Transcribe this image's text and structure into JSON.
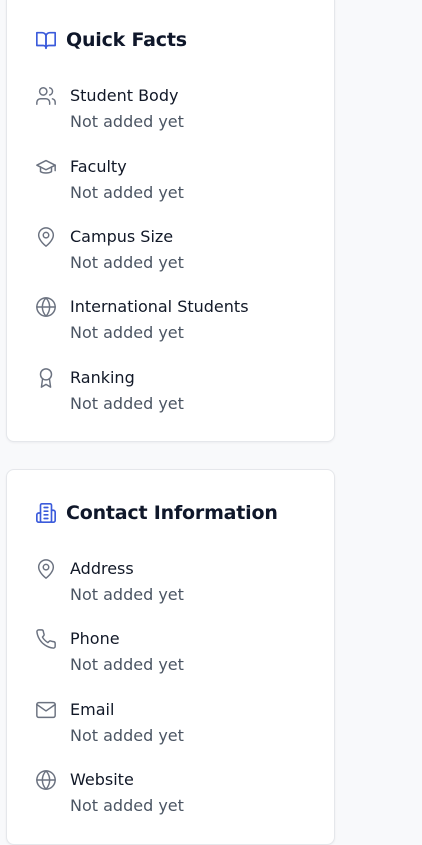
{
  "quick_facts": {
    "title": "Quick Facts",
    "items": [
      {
        "icon": "users-icon",
        "label": "Student Body",
        "value": "Not added yet"
      },
      {
        "icon": "graduation-cap-icon",
        "label": "Faculty",
        "value": "Not added yet"
      },
      {
        "icon": "map-pin-icon",
        "label": "Campus Size",
        "value": "Not added yet"
      },
      {
        "icon": "globe-icon",
        "label": "International Students",
        "value": "Not added yet"
      },
      {
        "icon": "award-icon",
        "label": "Ranking",
        "value": "Not added yet"
      }
    ]
  },
  "contact_information": {
    "title": "Contact Information",
    "items": [
      {
        "icon": "map-pin-icon",
        "label": "Address",
        "value": "Not added yet"
      },
      {
        "icon": "phone-icon",
        "label": "Phone",
        "value": "Not added yet"
      },
      {
        "icon": "mail-icon",
        "label": "Email",
        "value": "Not added yet"
      },
      {
        "icon": "globe-icon",
        "label": "Website",
        "value": "Not added yet"
      }
    ]
  },
  "colors": {
    "accent": "#3b5bdb",
    "icon_gray": "#6b7280",
    "title": "#0f172a",
    "value_text": "#4b5563"
  }
}
